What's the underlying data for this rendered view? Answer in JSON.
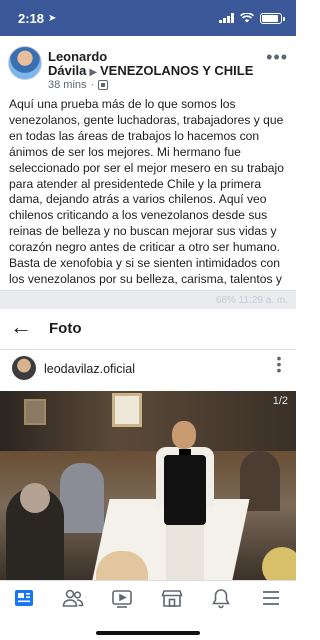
{
  "status_bar": {
    "time": "2:18",
    "location_icon": "location-arrow-icon",
    "battery_level": 0.9
  },
  "post": {
    "author": "Leonardo Dávila",
    "group": "VENEZOLANOS Y CHILE",
    "time_ago": "38 mins",
    "privacy_icon": "group-privacy-icon",
    "more_icon": "more-options-icon",
    "text": "Aquí una prueba más de lo que somos los venezolanos, gente luchadoras, trabajadores y que en todas las áreas de trabajos lo hacemos con ánimos de ser los mejores. Mi hermano fue seleccionado por ser el mejor mesero en su trabajo para atender al presidentede Chile y la primera dama, dejando atrás a varios chilenos. Aquí veo chilenos criticando a los venezolanos desde sus reinas de belleza y no buscan mejorar sus vidas y corazón negro antes de criticar a otro ser humano. Basta de xenofobia y si se sienten intimidados con los venezolanos por su belleza, carisma, talentos y otras cosas entonces trabajen y traten de ser mejores sin joder ni discriminar."
  },
  "shared_screenshot": {
    "ghost_status": "68% 11:29 a. m.",
    "back_icon": "back-arrow-icon",
    "title": "Foto",
    "ig_username": "leodavilaz.oficial",
    "photo_counter": "1/2",
    "photo_description_icon": "restaurant-photo"
  },
  "bottom_nav": {
    "items": [
      {
        "icon": "news-feed-icon",
        "active": true
      },
      {
        "icon": "friends-icon",
        "active": false
      },
      {
        "icon": "watch-icon",
        "active": false
      },
      {
        "icon": "marketplace-icon",
        "active": false
      },
      {
        "icon": "notifications-bell-icon",
        "active": false
      },
      {
        "icon": "menu-icon",
        "active": false
      }
    ]
  },
  "colors": {
    "facebook_blue": "#3b5998",
    "active_icon": "#1877f2",
    "inactive_icon": "#606770"
  }
}
